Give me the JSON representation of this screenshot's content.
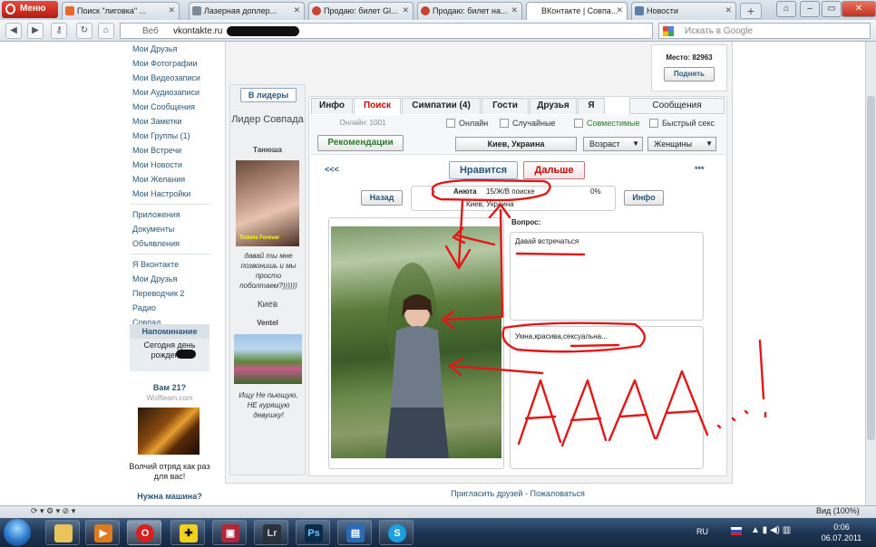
{
  "browser": {
    "menu_label": "Меню",
    "tabs": [
      {
        "label": "Поиск \"лиговка\" ...",
        "fav": "#e8692a"
      },
      {
        "label": "Лазерная доплер...",
        "fav": "#7a8a9a"
      },
      {
        "label": "Продаю: билет Gl...",
        "fav": "#c8462e"
      },
      {
        "label": "Продаю: билет на...",
        "fav": "#c8462e"
      },
      {
        "label": "ВКонтакте | Совпа...",
        "fav": "#5b7fa6"
      },
      {
        "label": "Новости",
        "fav": "#5b7fa6"
      }
    ],
    "url_mode": "Веб",
    "url": "vkontakte.ru",
    "search_placeholder": "Искать в Google",
    "zoom": "Вид (100%)"
  },
  "left_nav": {
    "group1": [
      "Мои Друзья",
      "Мои Фотографии",
      "Мои Видеозаписи",
      "Мои Аудиозаписи",
      "Мои Сообщения",
      "Мои Заметки",
      "Мои Группы (1)",
      "Мои Встречи",
      "Мои Новости",
      "Мои Желания",
      "Мои Настройки"
    ],
    "group2": [
      "Приложения",
      "Документы",
      "Объявления"
    ],
    "group3": [
      "Я Вконтакте",
      "Мои Друзья",
      "Переводчик 2",
      "Радио",
      "Совпад"
    ],
    "reminder_title": "Напоминание",
    "reminder_text": "Сегодня день рождения",
    "ad_title": "Вам 21?",
    "ad_site": "Wolfteam.com",
    "ad_text": "Волчий отряд как раз для вас!",
    "need_car": "Нужна машина?"
  },
  "app": {
    "place_label": "Место: 82963",
    "raise_button": "Поднять",
    "leaders_button": "В лидеры",
    "leader_title": "Лидер Совпада",
    "leader_name": "Танюша",
    "leader_photo_tag": "Tickets Forever",
    "leader_status": "давай ты мне позвонишь и мы просто поболтаем?))))))",
    "city": "Киев",
    "user2_name": "Ventel",
    "user2_status": "Ищу Не пьющую, НЕ курящую девушку!",
    "tabs": [
      "Инфо",
      "Поиск",
      "Симпатии (4)",
      "Гости",
      "Друзья",
      "Я"
    ],
    "messages_tab": "Сообщения",
    "online_count": "Онлайн: 1001",
    "filters": [
      "Онлайн",
      "Случайные",
      "Совместимые",
      "Быстрый секс"
    ],
    "recommend_button": "Рекомендации",
    "city_select": "Киев, Украина",
    "age_select": "Возраст",
    "gender_select": "Женщины",
    "prev": "<<<",
    "next": "***",
    "like_button": "Нравится",
    "next_button": "Дальше",
    "back_button": "Назад",
    "info_button": "Инфо",
    "profile_name": "Анюта",
    "profile_info": "15/Ж/В поиске",
    "profile_percent": "0%",
    "profile_city": "Киев, Украина",
    "question_label": "Вопрос:",
    "answer": "Давай встречаться",
    "about": "Умна,красива,сексуальна..."
  },
  "footer": {
    "invite": "Пригласить друзей",
    "sep": "-",
    "report": "Пожаловаться"
  },
  "annotation_text": "АААА...!",
  "taskbar": {
    "lang": "RU",
    "time": "0:06",
    "date": "06.07.2011"
  },
  "colors": {
    "vk_blue": "#2b587a",
    "annotation_red": "#e01818",
    "like_green": "#2a7a2a"
  }
}
